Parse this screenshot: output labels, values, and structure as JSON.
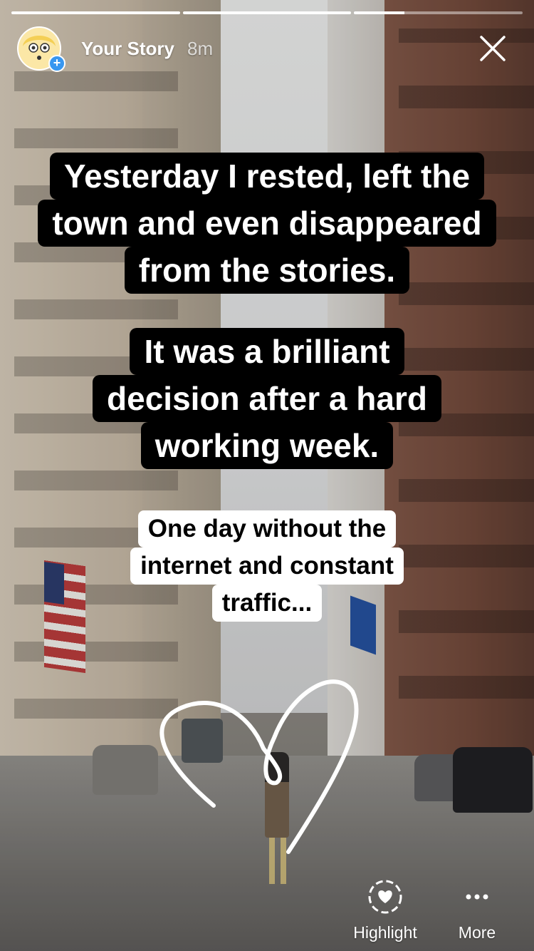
{
  "progress": {
    "segments": [
      1,
      1,
      0.3
    ]
  },
  "header": {
    "name": "Your Story",
    "time": "8m"
  },
  "icons": {
    "close": "close-icon",
    "avatar_badge": "plus-icon",
    "highlight": "heart-highlight-icon",
    "more": "more-dots-icon"
  },
  "captions": [
    {
      "lines": [
        "Yesterday I rested, left the",
        "town and even disappeared",
        "from the stories."
      ]
    },
    {
      "lines": [
        "It was a brilliant",
        "decision after a hard",
        "working week."
      ]
    },
    {
      "lines": [
        "One day without the",
        "internet and constant",
        "traffic..."
      ]
    }
  ],
  "footer": {
    "highlight_label": "Highlight",
    "more_label": "More"
  },
  "colors": {
    "accent": "#3897f0",
    "caption_dark": "#000000",
    "caption_light": "#ffffff"
  }
}
